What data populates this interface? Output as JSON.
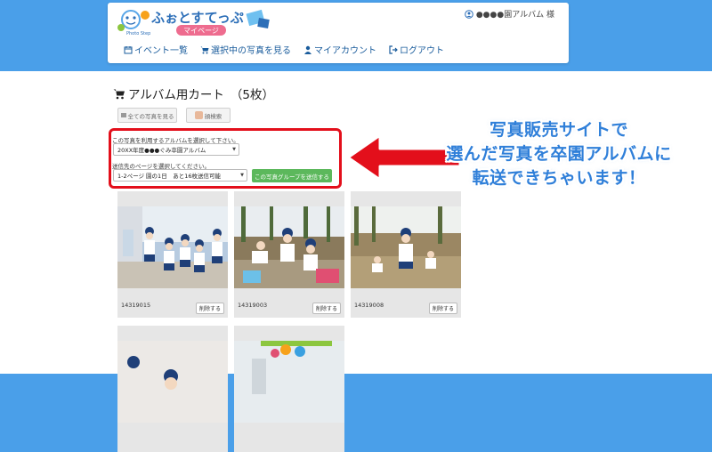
{
  "header": {
    "logo_text": "ふぉとすてっぷ",
    "logo_sub": "マイページ",
    "logo_tag": "Photo Step",
    "user_label": "●●●●園アルバム 様"
  },
  "nav": [
    {
      "label": "イベント一覧",
      "icon": "calendar-icon"
    },
    {
      "label": "選択中の写真を見る",
      "icon": "cart-icon"
    },
    {
      "label": "マイアカウント",
      "icon": "user-icon"
    },
    {
      "label": "ログアウト",
      "icon": "logout-icon"
    }
  ],
  "page": {
    "title": "アルバム用カート",
    "count": "（5枚）",
    "filter_all": "全ての写真を見る",
    "filter_face": "顔検索"
  },
  "form": {
    "album_label": "この写真を利用するアルバムを選択して下さい。",
    "album_value": "20XX年度●●●ぐみ卒園アルバム",
    "page_label": "送信先のページを選択してください。",
    "page_value": "1-2ページ 園の1日　あと16枚送信可能",
    "send_label": "この写真グループを送信する"
  },
  "annotation": {
    "line1": "写真販売サイトで",
    "line2": "選んだ写真を卒園アルバムに",
    "line3": "転送できちゃいます！"
  },
  "photos": [
    {
      "id": "14319015",
      "delete": "削除する"
    },
    {
      "id": "14319003",
      "delete": "削除する"
    },
    {
      "id": "14319008",
      "delete": "削除する"
    },
    {
      "id": "",
      "delete": ""
    },
    {
      "id": "",
      "delete": ""
    }
  ],
  "colors": {
    "header_bg": "#4a9fe9",
    "highlight": "#e30f1b",
    "annotation": "#2f7fd9",
    "send_button": "#5cb85c"
  }
}
